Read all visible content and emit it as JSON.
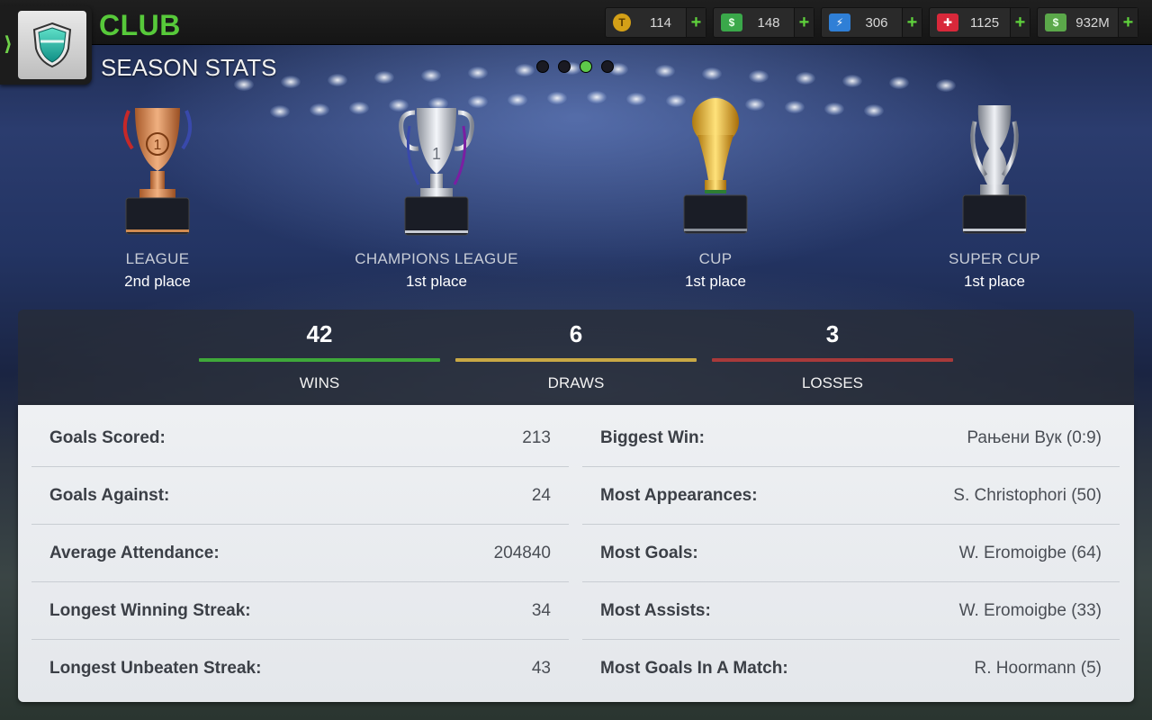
{
  "header": {
    "title": "CLUB",
    "subtitle": "SEASON STATS"
  },
  "currencies": [
    {
      "icon": "token-coin-icon",
      "value": "114",
      "color": "#d4a017"
    },
    {
      "icon": "cash-icon",
      "value": "148",
      "color": "#3aa84a"
    },
    {
      "icon": "energy-icon",
      "value": "306",
      "color": "#2f7fd6"
    },
    {
      "icon": "medical-icon",
      "value": "1125",
      "color": "#d8283a"
    },
    {
      "icon": "money-stack-icon",
      "value": "932M",
      "color": "#5ba84a"
    }
  ],
  "pagination": {
    "active_index": 2,
    "total": 4
  },
  "trophies": [
    {
      "icon": "league-trophy-icon",
      "name": "LEAGUE",
      "place": "2nd place"
    },
    {
      "icon": "champions-league-trophy-icon",
      "name": "CHAMPIONS LEAGUE",
      "place": "1st place"
    },
    {
      "icon": "cup-trophy-icon",
      "name": "CUP",
      "place": "1st place"
    },
    {
      "icon": "super-cup-trophy-icon",
      "name": "SUPER CUP",
      "place": "1st place"
    }
  ],
  "record": {
    "wins": {
      "value": "42",
      "label": "WINS",
      "color": "#3fa83a"
    },
    "draws": {
      "value": "6",
      "label": "DRAWS",
      "color": "#c9a845"
    },
    "losses": {
      "value": "3",
      "label": "LOSSES",
      "color": "#a83a3a"
    }
  },
  "stats_left": [
    {
      "label": "Goals Scored:",
      "value": "213"
    },
    {
      "label": "Goals Against:",
      "value": "24"
    },
    {
      "label": "Average Attendance:",
      "value": "204840"
    },
    {
      "label": "Longest Winning Streak:",
      "value": "34"
    },
    {
      "label": "Longest Unbeaten Streak:",
      "value": "43"
    }
  ],
  "stats_right": [
    {
      "label": "Biggest Win:",
      "value": "Рањени Вук (0:9)"
    },
    {
      "label": "Most Appearances:",
      "value": "S. Christophori (50)"
    },
    {
      "label": "Most Goals:",
      "value": "W. Eromoigbe (64)"
    },
    {
      "label": "Most Assists:",
      "value": "W. Eromoigbe (33)"
    },
    {
      "label": "Most Goals In A Match:",
      "value": "R. Hoormann (5)"
    }
  ]
}
